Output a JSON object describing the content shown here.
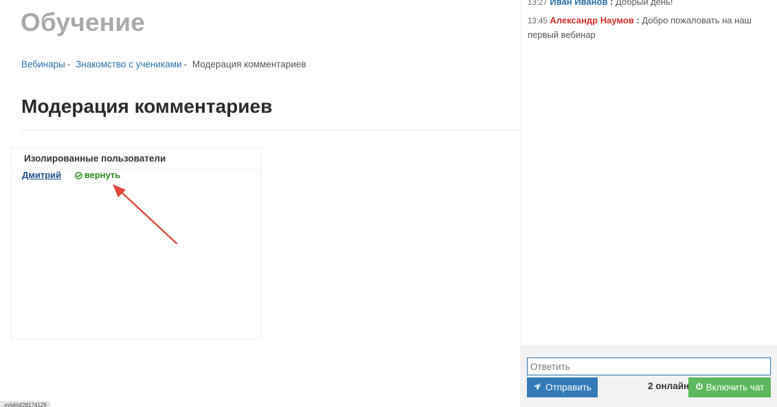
{
  "header": {
    "title": "Обучение"
  },
  "breadcrumb": {
    "items": [
      "Вебинары",
      "Знакомство с учениками"
    ],
    "current": "Модерация комментариев",
    "separator": "-"
  },
  "section": {
    "title": "Модерация комментариев"
  },
  "isolated_panel": {
    "heading": "Изолированные пользователи",
    "users": [
      {
        "name": "Дмитрий",
        "action_label": "вернуть",
        "action_icon": "check-circle-icon"
      }
    ]
  },
  "annotation": {
    "arrow_color": "#e0463a"
  },
  "status_bar": {
    "url": "..m/pl/pl/28174129"
  },
  "chat": {
    "messages": [
      {
        "time": "13:27",
        "author": "Иван Иванов",
        "author_color": "#2a6fa8",
        "text": "Добрый день!"
      },
      {
        "time": "13:45",
        "author": "Александр Наумов",
        "author_color": "#d22a2a",
        "text": "Добро пожаловать на наш первый вебинар"
      }
    ],
    "input_placeholder": "Ответить",
    "send_label": "Отправить",
    "online_text": "2 онлайн",
    "enable_chat_label": "Включить чат",
    "colors": {
      "send": "#337ab7",
      "enable": "#5cb85c"
    }
  }
}
